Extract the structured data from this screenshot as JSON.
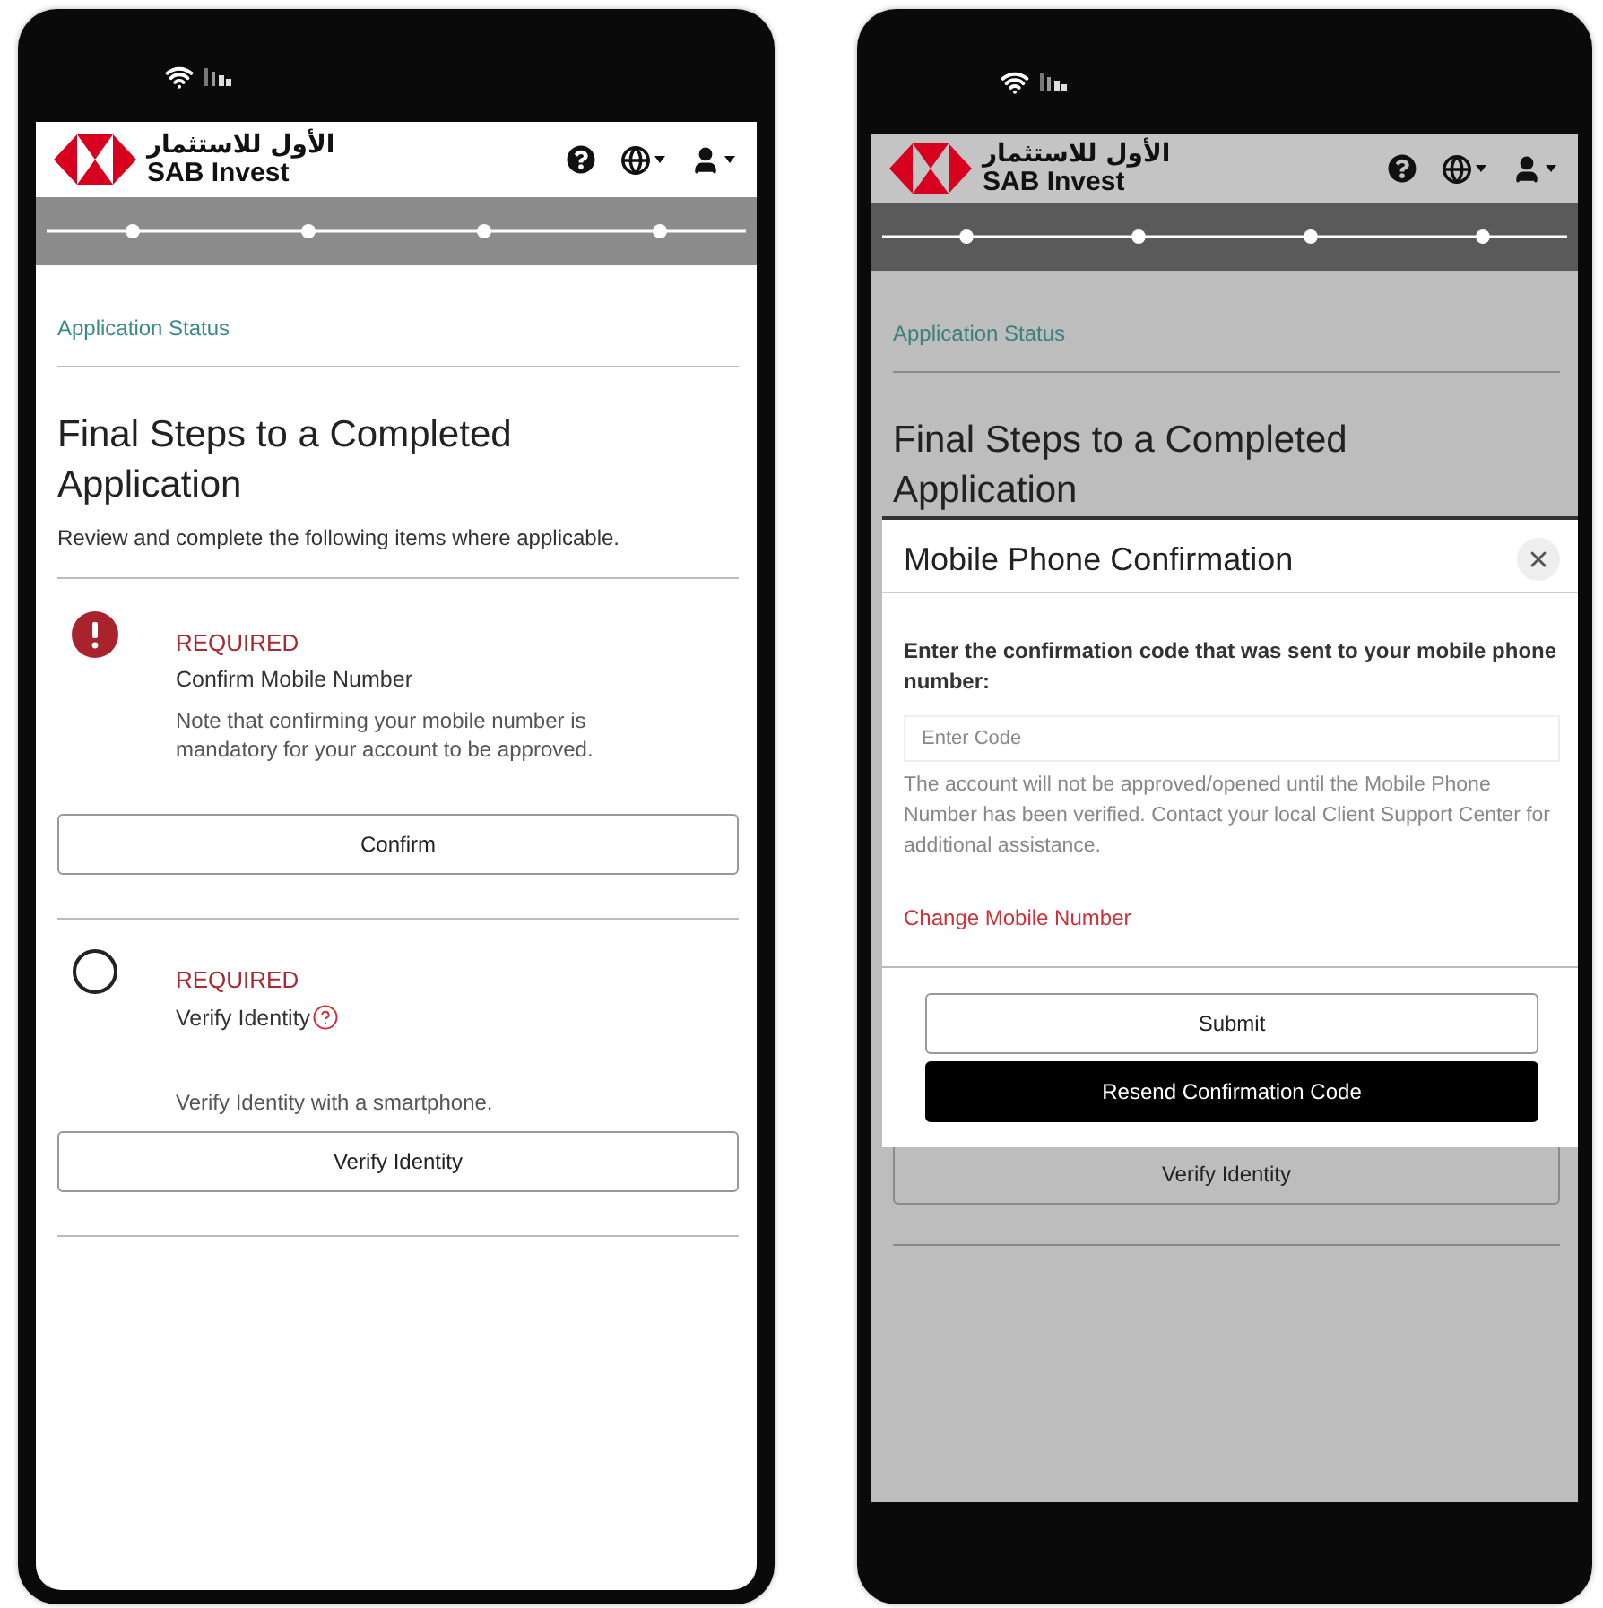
{
  "phones": [
    {
      "dimmed": false,
      "header": {
        "brand_arabic": "الأول للاستثمار",
        "brand": "SAB Invest"
      },
      "breadcrumb": "Application Status",
      "title": "Final Steps to a Completed Application",
      "subtitle": "Review and complete the following items where applicable.",
      "items": [
        {
          "kind": "alert",
          "tag": "REQUIRED",
          "name": "Confirm Mobile Number",
          "help": false,
          "note": "Note that confirming your mobile number is mandatory for your account to be approved.",
          "button": "Confirm"
        },
        {
          "kind": "pending",
          "tag": "REQUIRED",
          "name": "Verify Identity",
          "help": true,
          "note": "Verify Identity with a smartphone.",
          "button": "Verify Identity"
        }
      ]
    },
    {
      "dimmed": true,
      "header": {
        "brand_arabic": "الأول للاستثمار",
        "brand": "SAB Invest"
      },
      "breadcrumb": "Application Status",
      "title": "Final Steps to a Completed Application",
      "items": [
        {
          "button": "Verify Identity"
        }
      ],
      "modal": {
        "title": "Mobile Phone Confirmation",
        "label": "Enter the confirmation code that was sent to your mobile phone number:",
        "placeholder": "Enter Code",
        "help": "The account will not be approved/opened until the Mobile Phone Number has been verified. Contact your local Client Support Center for additional assistance.",
        "link": "Change Mobile Number",
        "buttons": [
          {
            "label": "Submit",
            "primary": false
          },
          {
            "label": "Resend Confirmation Code",
            "primary": true
          }
        ]
      }
    }
  ]
}
